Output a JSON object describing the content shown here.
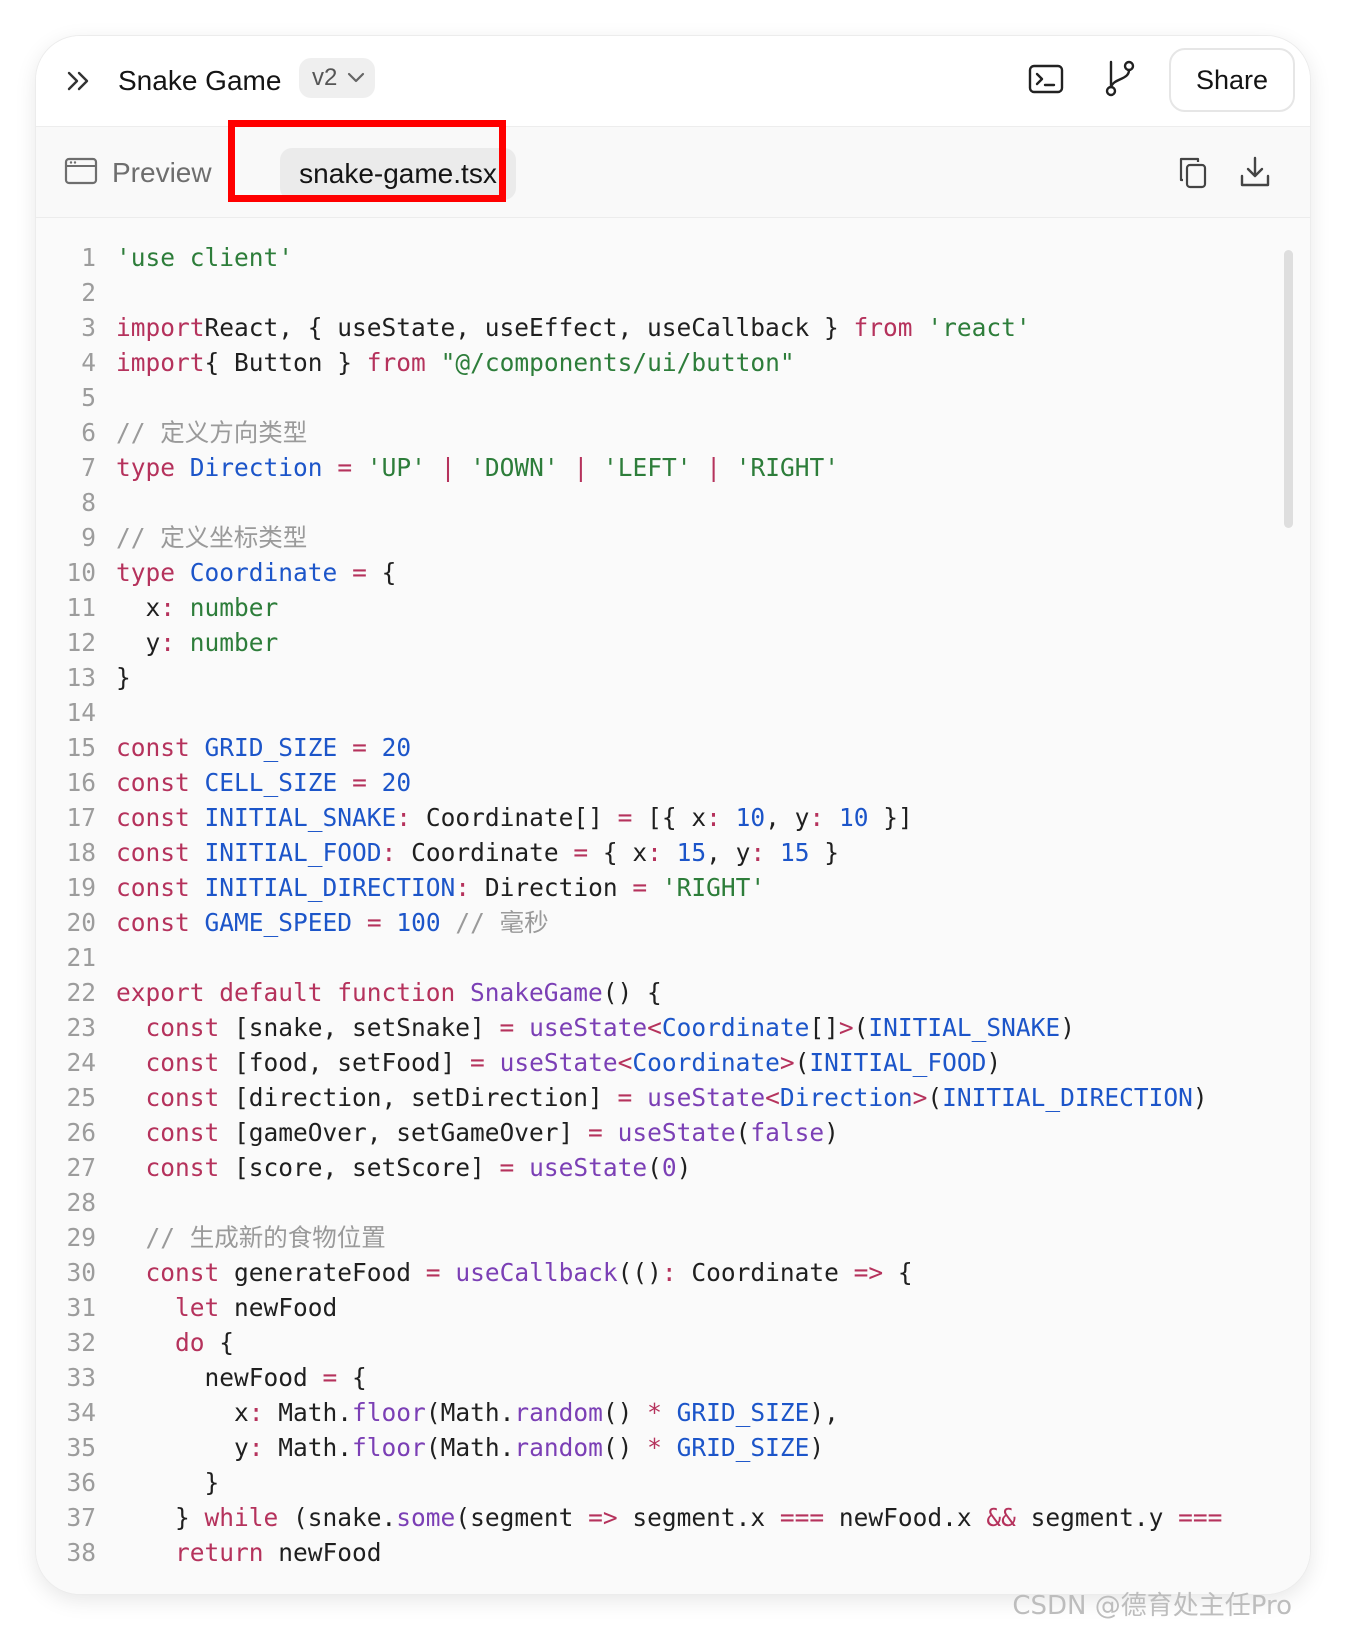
{
  "header": {
    "title": "Snake Game",
    "version": "v2",
    "share_label": "Share"
  },
  "tabs": {
    "preview_label": "Preview",
    "file_label": "snake-game.tsx"
  },
  "icons": {
    "expand": "chevrons-right-icon",
    "terminal": "terminal-icon",
    "branch": "git-branch-icon",
    "preview": "window-icon",
    "copy": "copy-icon",
    "download": "download-icon"
  },
  "colors": {
    "keyword": "#b5325c",
    "string": "#2d7d3a",
    "comment": "#9a9a9a",
    "function": "#7b3fb5",
    "number": "#1c55c9",
    "highlight": "#ff0000"
  },
  "code": {
    "lines": [
      [
        [
          "str",
          "'use client'"
        ]
      ],
      [],
      [
        [
          "kw",
          "import"
        ],
        [
          "",
          "React, { useState, useEffect, useCallback } "
        ],
        [
          "kw",
          "from"
        ],
        [
          "",
          " "
        ],
        [
          "str",
          "'react'"
        ]
      ],
      [
        [
          "kw",
          "import"
        ],
        [
          "",
          ""
        ],
        [
          "",
          "{ Button } "
        ],
        [
          "kw",
          "from"
        ],
        [
          "",
          " "
        ],
        [
          "str",
          "\"@/components/ui/button\""
        ]
      ],
      [],
      [
        [
          "cmt",
          "// 定义方向类型"
        ]
      ],
      [
        [
          "kw",
          "type"
        ],
        [
          "",
          " "
        ],
        [
          "typ",
          "Direction"
        ],
        [
          "",
          " "
        ],
        [
          "op",
          "="
        ],
        [
          "",
          " "
        ],
        [
          "str",
          "'UP'"
        ],
        [
          "",
          " "
        ],
        [
          "op",
          "|"
        ],
        [
          "",
          " "
        ],
        [
          "str",
          "'DOWN'"
        ],
        [
          "",
          " "
        ],
        [
          "op",
          "|"
        ],
        [
          "",
          " "
        ],
        [
          "str",
          "'LEFT'"
        ],
        [
          "",
          " "
        ],
        [
          "op",
          "|"
        ],
        [
          "",
          " "
        ],
        [
          "str",
          "'RIGHT'"
        ]
      ],
      [],
      [
        [
          "cmt",
          "// 定义坐标类型"
        ]
      ],
      [
        [
          "kw",
          "type"
        ],
        [
          "",
          " "
        ],
        [
          "typ",
          "Coordinate"
        ],
        [
          "",
          " "
        ],
        [
          "op",
          "="
        ],
        [
          "",
          " {"
        ]
      ],
      [
        [
          "",
          "  x"
        ],
        [
          "op",
          ":"
        ],
        [
          "",
          " "
        ],
        [
          "str",
          "number"
        ]
      ],
      [
        [
          "",
          "  y"
        ],
        [
          "op",
          ":"
        ],
        [
          "",
          " "
        ],
        [
          "str",
          "number"
        ]
      ],
      [
        [
          "",
          "}"
        ]
      ],
      [],
      [
        [
          "kw",
          "const"
        ],
        [
          "",
          " "
        ],
        [
          "id",
          "GRID_SIZE"
        ],
        [
          "",
          " "
        ],
        [
          "op",
          "="
        ],
        [
          "",
          " "
        ],
        [
          "num",
          "20"
        ]
      ],
      [
        [
          "kw",
          "const"
        ],
        [
          "",
          " "
        ],
        [
          "id",
          "CELL_SIZE"
        ],
        [
          "",
          " "
        ],
        [
          "op",
          "="
        ],
        [
          "",
          " "
        ],
        [
          "num",
          "20"
        ]
      ],
      [
        [
          "kw",
          "const"
        ],
        [
          "",
          " "
        ],
        [
          "id",
          "INITIAL_SNAKE"
        ],
        [
          "op",
          ":"
        ],
        [
          "",
          " Coordinate[] "
        ],
        [
          "op",
          "="
        ],
        [
          "",
          " [{ x"
        ],
        [
          "op",
          ":"
        ],
        [
          "",
          " "
        ],
        [
          "num",
          "10"
        ],
        [
          "",
          ", y"
        ],
        [
          "op",
          ":"
        ],
        [
          "",
          " "
        ],
        [
          "num",
          "10"
        ],
        [
          "",
          " }]"
        ]
      ],
      [
        [
          "kw",
          "const"
        ],
        [
          "",
          " "
        ],
        [
          "id",
          "INITIAL_FOOD"
        ],
        [
          "op",
          ":"
        ],
        [
          "",
          " Coordinate "
        ],
        [
          "op",
          "="
        ],
        [
          "",
          " { x"
        ],
        [
          "op",
          ":"
        ],
        [
          "",
          " "
        ],
        [
          "num",
          "15"
        ],
        [
          "",
          ", y"
        ],
        [
          "op",
          ":"
        ],
        [
          "",
          " "
        ],
        [
          "num",
          "15"
        ],
        [
          "",
          " }"
        ]
      ],
      [
        [
          "kw",
          "const"
        ],
        [
          "",
          " "
        ],
        [
          "id",
          "INITIAL_DIRECTION"
        ],
        [
          "op",
          ":"
        ],
        [
          "",
          " Direction "
        ],
        [
          "op",
          "="
        ],
        [
          "",
          " "
        ],
        [
          "str",
          "'RIGHT'"
        ]
      ],
      [
        [
          "kw",
          "const"
        ],
        [
          "",
          " "
        ],
        [
          "id",
          "GAME_SPEED"
        ],
        [
          "",
          " "
        ],
        [
          "op",
          "="
        ],
        [
          "",
          " "
        ],
        [
          "num",
          "100"
        ],
        [
          "",
          " "
        ],
        [
          "cmt",
          "// 毫秒"
        ]
      ],
      [],
      [
        [
          "kw",
          "export default function"
        ],
        [
          "",
          " "
        ],
        [
          "fn",
          "SnakeGame"
        ],
        [
          "",
          "() {"
        ]
      ],
      [
        [
          "",
          "  "
        ],
        [
          "kw",
          "const"
        ],
        [
          "",
          " [snake, setSnake] "
        ],
        [
          "op",
          "="
        ],
        [
          "",
          " "
        ],
        [
          "fn",
          "useState"
        ],
        [
          "op",
          "<"
        ],
        [
          "typ",
          "Coordinate"
        ],
        [
          "",
          "[]"
        ],
        [
          "op",
          ">"
        ],
        [
          "",
          "("
        ],
        [
          "id",
          "INITIAL_SNAKE"
        ],
        [
          "",
          ")"
        ]
      ],
      [
        [
          "",
          "  "
        ],
        [
          "kw",
          "const"
        ],
        [
          "",
          " [food, setFood] "
        ],
        [
          "op",
          "="
        ],
        [
          "",
          " "
        ],
        [
          "fn",
          "useState"
        ],
        [
          "op",
          "<"
        ],
        [
          "typ",
          "Coordinate"
        ],
        [
          "op",
          ">"
        ],
        [
          "",
          "("
        ],
        [
          "id",
          "INITIAL_FOOD"
        ],
        [
          "",
          ")"
        ]
      ],
      [
        [
          "",
          "  "
        ],
        [
          "kw",
          "const"
        ],
        [
          "",
          " [direction, setDirection] "
        ],
        [
          "op",
          "="
        ],
        [
          "",
          " "
        ],
        [
          "fn",
          "useState"
        ],
        [
          "op",
          "<"
        ],
        [
          "typ",
          "Direction"
        ],
        [
          "op",
          ">"
        ],
        [
          "",
          "("
        ],
        [
          "id",
          "INITIAL_DIRECTION"
        ],
        [
          "",
          ")"
        ]
      ],
      [
        [
          "",
          "  "
        ],
        [
          "kw",
          "const"
        ],
        [
          "",
          " [gameOver, setGameOver] "
        ],
        [
          "op",
          "="
        ],
        [
          "",
          " "
        ],
        [
          "fn",
          "useState"
        ],
        [
          "",
          "("
        ],
        [
          "fn",
          "false"
        ],
        [
          "",
          ")"
        ]
      ],
      [
        [
          "",
          "  "
        ],
        [
          "kw",
          "const"
        ],
        [
          "",
          " [score, setScore] "
        ],
        [
          "op",
          "="
        ],
        [
          "",
          " "
        ],
        [
          "fn",
          "useState"
        ],
        [
          "",
          "("
        ],
        [
          "fn",
          "0"
        ],
        [
          "",
          ")"
        ]
      ],
      [],
      [
        [
          "",
          "  "
        ],
        [
          "cmt",
          "// 生成新的食物位置"
        ]
      ],
      [
        [
          "",
          "  "
        ],
        [
          "kw",
          "const"
        ],
        [
          "",
          " generateFood "
        ],
        [
          "op",
          "="
        ],
        [
          "",
          " "
        ],
        [
          "fn",
          "useCallback"
        ],
        [
          "",
          "(()"
        ],
        [
          "op",
          ":"
        ],
        [
          "",
          " Coordinate "
        ],
        [
          "op",
          "=>"
        ],
        [
          "",
          " {"
        ]
      ],
      [
        [
          "",
          "    "
        ],
        [
          "kw",
          "let"
        ],
        [
          "",
          " newFood"
        ]
      ],
      [
        [
          "",
          "    "
        ],
        [
          "kw",
          "do"
        ],
        [
          "",
          " {"
        ]
      ],
      [
        [
          "",
          "      newFood "
        ],
        [
          "op",
          "="
        ],
        [
          "",
          " {"
        ]
      ],
      [
        [
          "",
          "        x"
        ],
        [
          "op",
          ":"
        ],
        [
          "",
          " Math."
        ],
        [
          "fn",
          "floor"
        ],
        [
          "",
          "(Math."
        ],
        [
          "fn",
          "random"
        ],
        [
          "",
          "() "
        ],
        [
          "op",
          "*"
        ],
        [
          "",
          " "
        ],
        [
          "id",
          "GRID_SIZE"
        ],
        [
          "",
          "),"
        ]
      ],
      [
        [
          "",
          "        y"
        ],
        [
          "op",
          ":"
        ],
        [
          "",
          " Math."
        ],
        [
          "fn",
          "floor"
        ],
        [
          "",
          "(Math."
        ],
        [
          "fn",
          "random"
        ],
        [
          "",
          "() "
        ],
        [
          "op",
          "*"
        ],
        [
          "",
          " "
        ],
        [
          "id",
          "GRID_SIZE"
        ],
        [
          "",
          ")"
        ]
      ],
      [
        [
          "",
          "      }"
        ]
      ],
      [
        [
          "",
          "    } "
        ],
        [
          "kw",
          "while"
        ],
        [
          "",
          " (snake."
        ],
        [
          "fn",
          "some"
        ],
        [
          "",
          "(segment "
        ],
        [
          "op",
          "=>"
        ],
        [
          "",
          " segment.x "
        ],
        [
          "op",
          "==="
        ],
        [
          "",
          " newFood.x "
        ],
        [
          "op",
          "&&"
        ],
        [
          "",
          " segment.y "
        ],
        [
          "op",
          "==="
        ]
      ],
      [
        [
          "",
          "    "
        ],
        [
          "kw",
          "return"
        ],
        [
          "",
          " newFood"
        ]
      ]
    ]
  },
  "watermark": "CSDN @德育处主任Pro"
}
